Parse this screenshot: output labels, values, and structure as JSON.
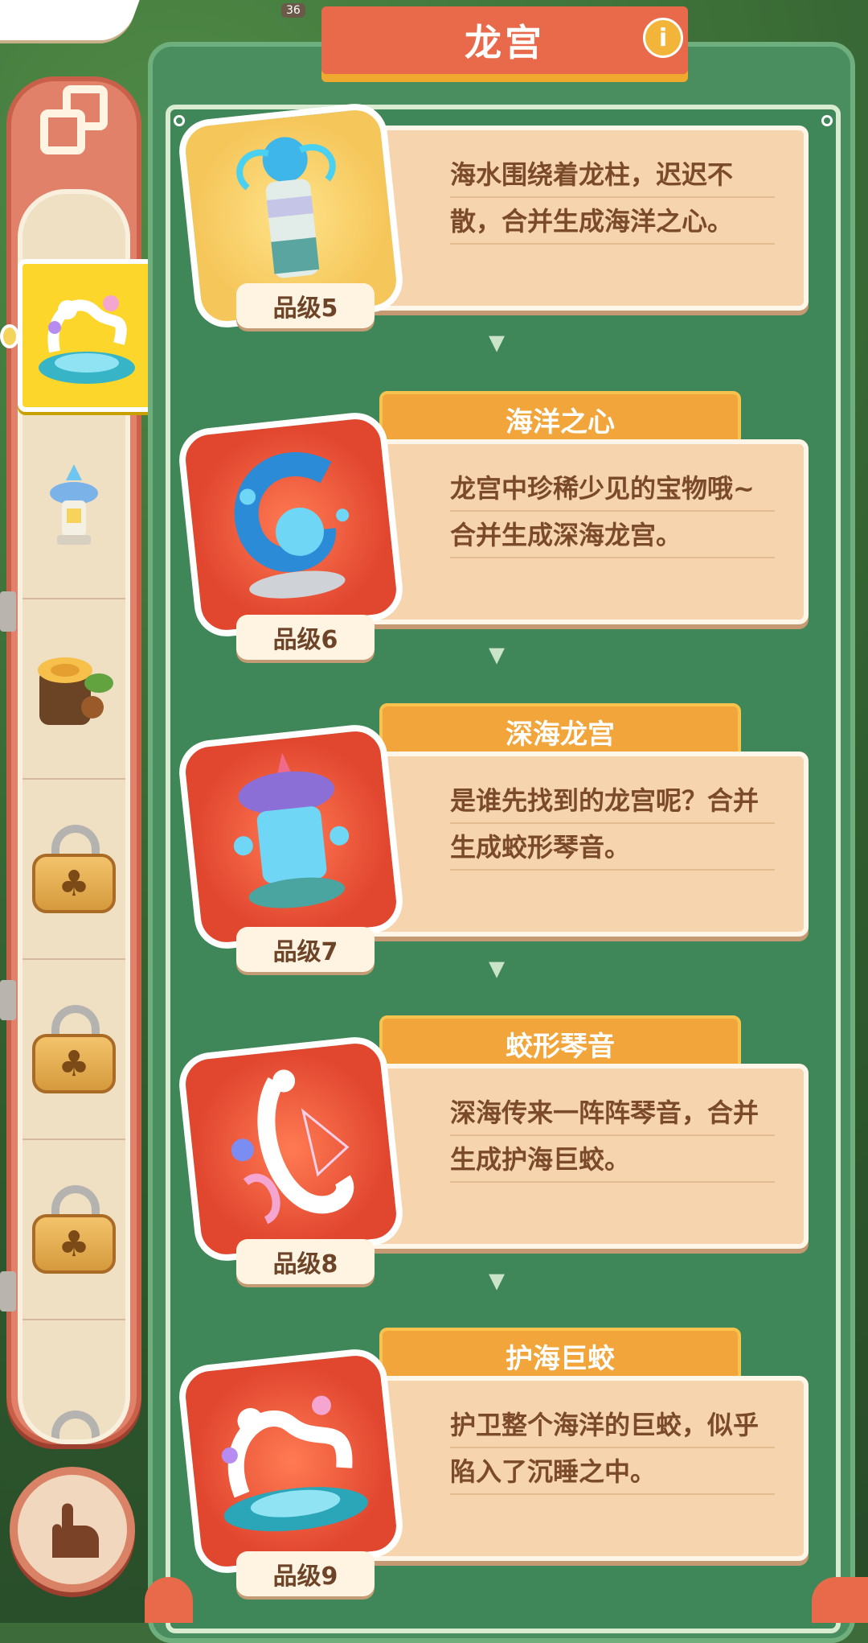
{
  "header": {
    "title": "龙宫",
    "top_counter": "36"
  },
  "sidebar": {
    "selected_index": 0
  },
  "items": [
    {
      "name": "",
      "grade": "品级5",
      "description": "海水围绕着龙柱，迟迟不散，合并生成海洋之心。",
      "image_icon": "dragon-pillar-icon",
      "image_bg": "#f5c65a"
    },
    {
      "name": "海洋之心",
      "grade": "品级6",
      "description": "龙宫中珍稀少见的宝物哦~合并生成深海龙宫。",
      "image_icon": "ocean-heart-icon",
      "image_bg": "#e1462f"
    },
    {
      "name": "深海龙宫",
      "grade": "品级7",
      "description": "是谁先找到的龙宫呢？合并生成蛟形琴音。",
      "image_icon": "deep-sea-palace-icon",
      "image_bg": "#e1462f"
    },
    {
      "name": "蛟形琴音",
      "grade": "品级8",
      "description": "深海传来一阵阵琴音，合并生成护海巨蛟。",
      "image_icon": "dragon-harp-icon",
      "image_bg": "#e1462f"
    },
    {
      "name": "护海巨蛟",
      "grade": "品级9",
      "description": "护卫整个海洋的巨蛟，似乎陷入了沉睡之中。",
      "image_icon": "guardian-dragon-icon",
      "image_bg": "#e1462f"
    }
  ],
  "colors": {
    "accent": "#e86a4a",
    "tab": "#f2a53a",
    "card": "#f6d4ae",
    "panel": "#3f8658",
    "selected": "#fcd62a"
  }
}
